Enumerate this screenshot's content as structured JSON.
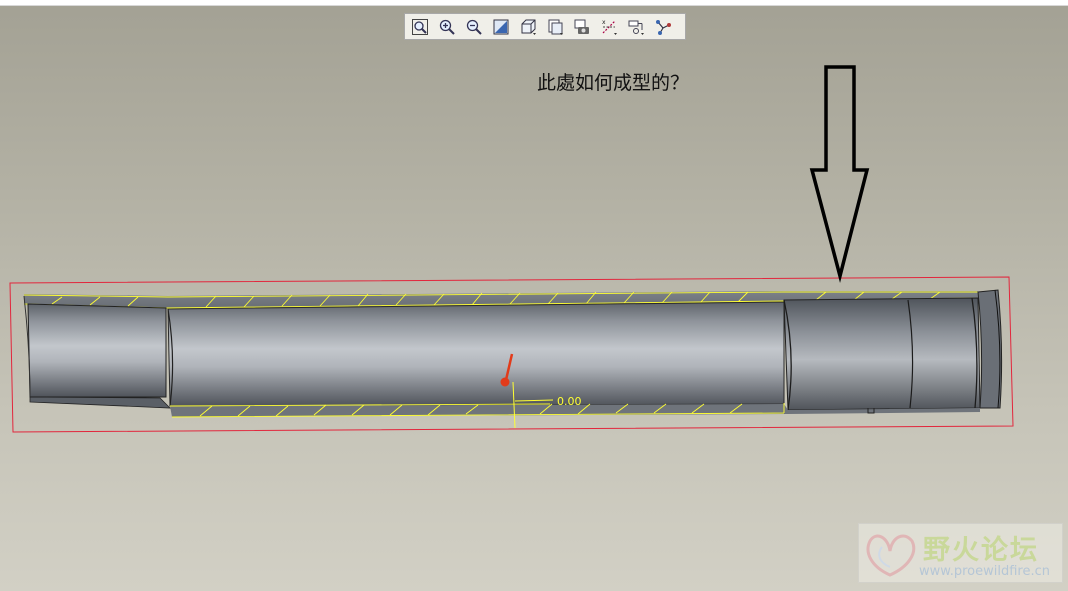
{
  "annotation": {
    "question_text": "此處如何成型的？"
  },
  "dimension": {
    "value": "0.00"
  },
  "toolbar": {
    "buttons": [
      {
        "name": "zoom-fit-icon",
        "label": "Refit"
      },
      {
        "name": "zoom-in-icon",
        "label": "Zoom In"
      },
      {
        "name": "zoom-out-icon",
        "label": "Zoom Out"
      },
      {
        "name": "repaint-icon",
        "label": "Repaint"
      },
      {
        "name": "display-style-icon",
        "label": "Display Style"
      },
      {
        "name": "saved-views-icon",
        "label": "Saved Views"
      },
      {
        "name": "view-manager-icon",
        "label": "View Manager"
      },
      {
        "name": "datum-display-icon",
        "label": "Datum Display"
      },
      {
        "name": "annotation-display-icon",
        "label": "Annotation Display"
      },
      {
        "name": "spin-center-icon",
        "label": "Spin Center"
      }
    ]
  },
  "watermark": {
    "title": "野火论坛",
    "url": "www.proewildfire.cn"
  },
  "colors": {
    "background_top": "#a3a194",
    "background_bottom": "#d2d0c5",
    "part_gray": "#8d9299",
    "section_hatch": "#ffff00",
    "selection_box": "#e2263c",
    "arrow": "#000000",
    "csys_marker": "#e23b1a"
  }
}
